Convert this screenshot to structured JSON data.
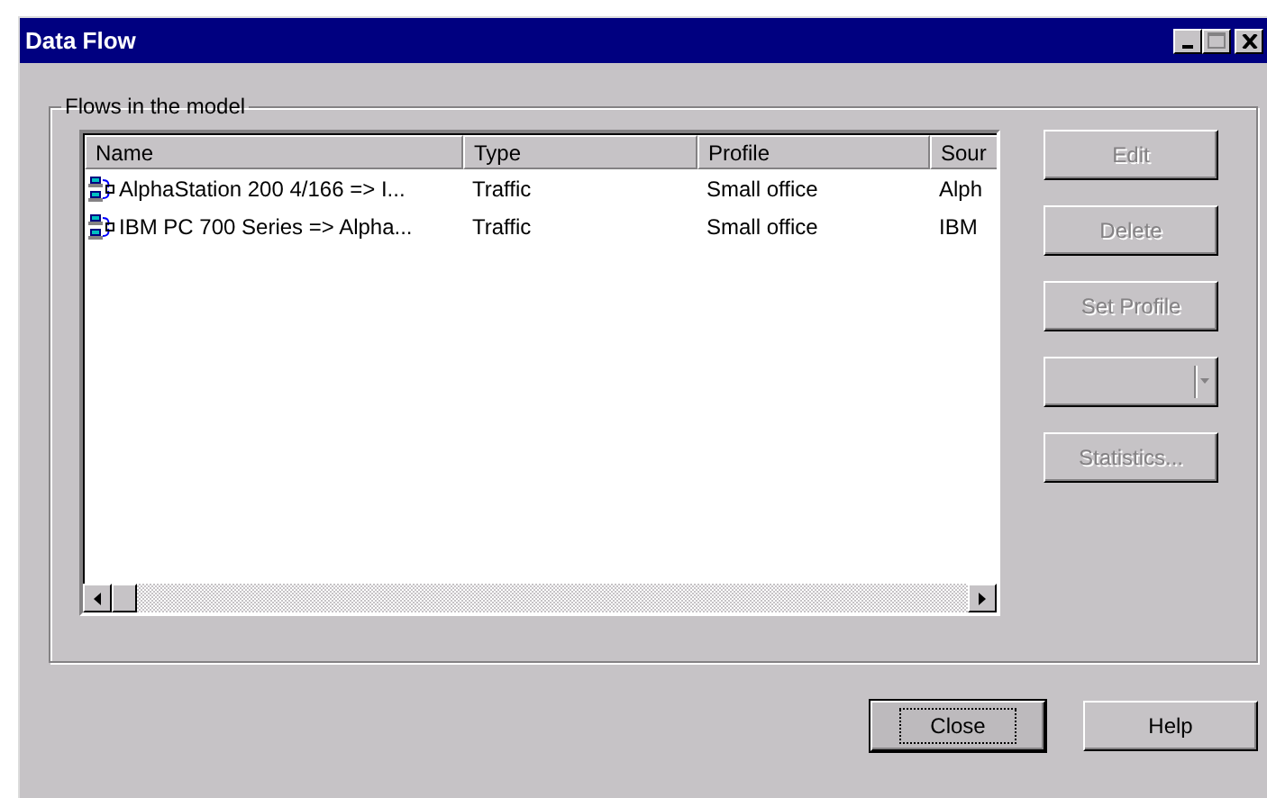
{
  "window": {
    "title": "Data Flow"
  },
  "group": {
    "label": "Flows in the model"
  },
  "table": {
    "columns": [
      "Name",
      "Type",
      "Profile",
      "Sour"
    ],
    "rows": [
      [
        "AlphaStation 200 4/166 => I...",
        "Traffic",
        "Small office",
        "Alph"
      ],
      [
        "IBM PC 700 Series => Alpha...",
        "Traffic",
        "Small office",
        "IBM"
      ]
    ]
  },
  "side_buttons": [
    {
      "kind": "button",
      "label": "Edit",
      "disabled": true
    },
    {
      "kind": "button",
      "label": "Delete",
      "disabled": true
    },
    {
      "kind": "button",
      "label": "Set Profile",
      "disabled": true
    },
    {
      "kind": "combo",
      "disabled": true
    },
    {
      "kind": "button",
      "label": "Statistics...",
      "disabled": true
    }
  ],
  "footer_buttons": [
    {
      "label": "Close",
      "focused": true
    },
    {
      "label": "Help",
      "focused": false
    }
  ]
}
